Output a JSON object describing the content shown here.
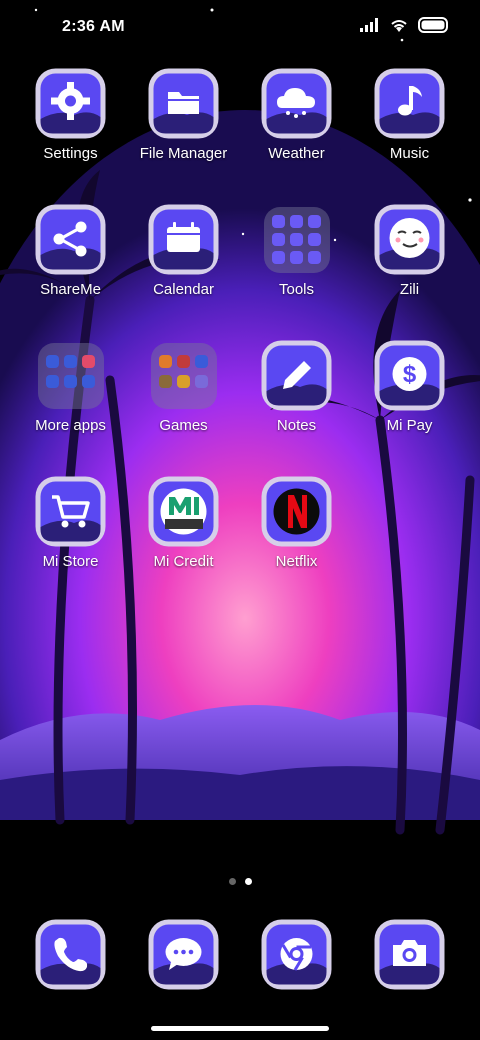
{
  "status_bar": {
    "time": "2:36 AM"
  },
  "grid": [
    {
      "label": "Settings",
      "icon": "gear-icon"
    },
    {
      "label": "File Manager",
      "icon": "folder-icon"
    },
    {
      "label": "Weather",
      "icon": "cloud-icon"
    },
    {
      "label": "Music",
      "icon": "music-note-icon"
    },
    {
      "label": "ShareMe",
      "icon": "share-icon"
    },
    {
      "label": "Calendar",
      "icon": "calendar-icon"
    },
    {
      "label": "Tools",
      "icon": "folder-icon"
    },
    {
      "label": "Zili",
      "icon": "smiley-icon"
    },
    {
      "label": "More apps",
      "icon": "folder-icon"
    },
    {
      "label": "Games",
      "icon": "folder-icon"
    },
    {
      "label": "Notes",
      "icon": "pencil-icon"
    },
    {
      "label": "Mi Pay",
      "icon": "dollar-icon"
    },
    {
      "label": "Mi Store",
      "icon": "cart-icon"
    },
    {
      "label": "Mi Credit",
      "icon": "mi-credit-icon"
    },
    {
      "label": "Netflix",
      "icon": "netflix-icon"
    }
  ],
  "dock": [
    {
      "icon": "phone-icon"
    },
    {
      "icon": "message-icon"
    },
    {
      "icon": "chrome-icon"
    },
    {
      "icon": "camera-icon"
    }
  ],
  "colors": {
    "accent": "#5a48f2",
    "frame": "#d6cfe9",
    "page_dot_active": "#ffffff"
  }
}
